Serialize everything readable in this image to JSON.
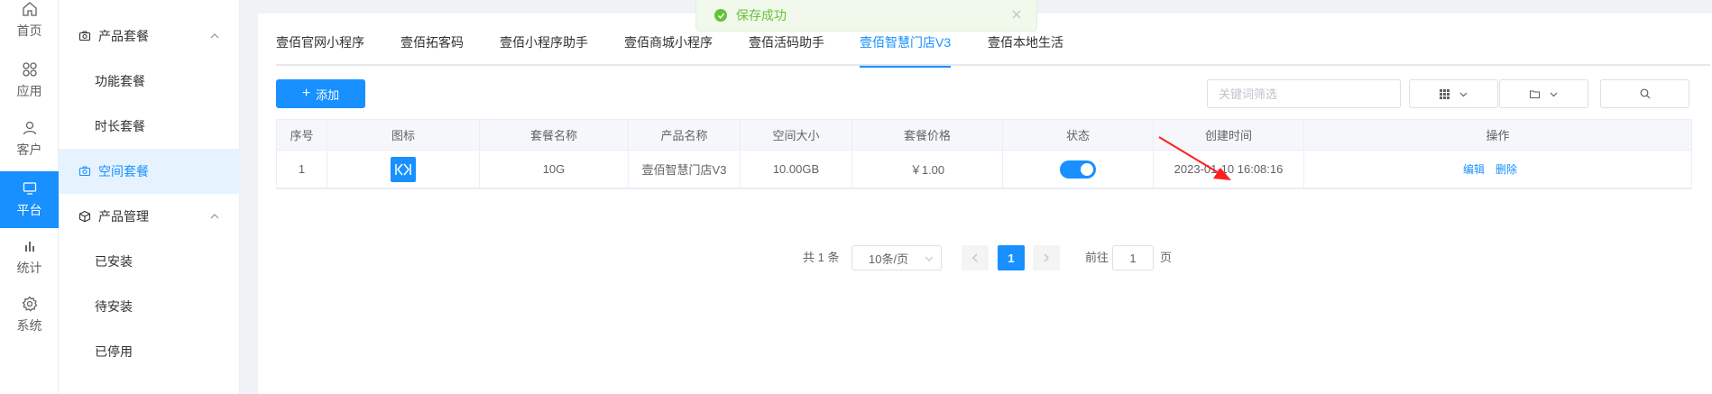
{
  "rail": {
    "items": [
      {
        "label": "首页",
        "icon": "home-icon"
      },
      {
        "label": "应用",
        "icon": "apps-icon"
      },
      {
        "label": "客户",
        "icon": "user-icon"
      },
      {
        "label": "平台",
        "icon": "monitor-icon",
        "active": true
      },
      {
        "label": "统计",
        "icon": "bar-chart-icon"
      },
      {
        "label": "系统",
        "icon": "gear-icon"
      }
    ]
  },
  "submenu": {
    "group1": "产品套餐",
    "items1": [
      "功能套餐",
      "时长套餐",
      "空间套餐"
    ],
    "group2": "产品管理",
    "items2": [
      "已安装",
      "待安装",
      "已停用"
    ]
  },
  "tabs": [
    "壹佰官网小程序",
    "壹佰拓客码",
    "壹佰小程序助手",
    "壹佰商城小程序",
    "壹佰活码助手",
    "壹佰智慧门店V3",
    "壹佰本地生活"
  ],
  "active_tab": "壹佰智慧门店V3",
  "toolbar": {
    "add_label": "添加",
    "keyword_placeholder": "关键词筛选"
  },
  "table": {
    "headers": [
      "序号",
      "图标",
      "套餐名称",
      "产品名称",
      "空间大小",
      "套餐价格",
      "状态",
      "创建时间",
      "操作"
    ],
    "rows": [
      {
        "index": "1",
        "name": "10G",
        "product": "壹佰智慧门店V3",
        "size": "10.00GB",
        "price": "￥1.00",
        "status_on": true,
        "created": "2023-01-10 16:08:16",
        "edit": "编辑",
        "delete": "删除"
      }
    ]
  },
  "pagination": {
    "total": "共 1 条",
    "page_size": "10条/页",
    "current": "1",
    "goto_label": "前往",
    "goto_value": "1",
    "page_suffix": "页"
  },
  "toast": {
    "message": "保存成功"
  },
  "colors": {
    "primary": "#1890ff",
    "success": "#67c23a",
    "annotation": "#ff1f1f"
  }
}
